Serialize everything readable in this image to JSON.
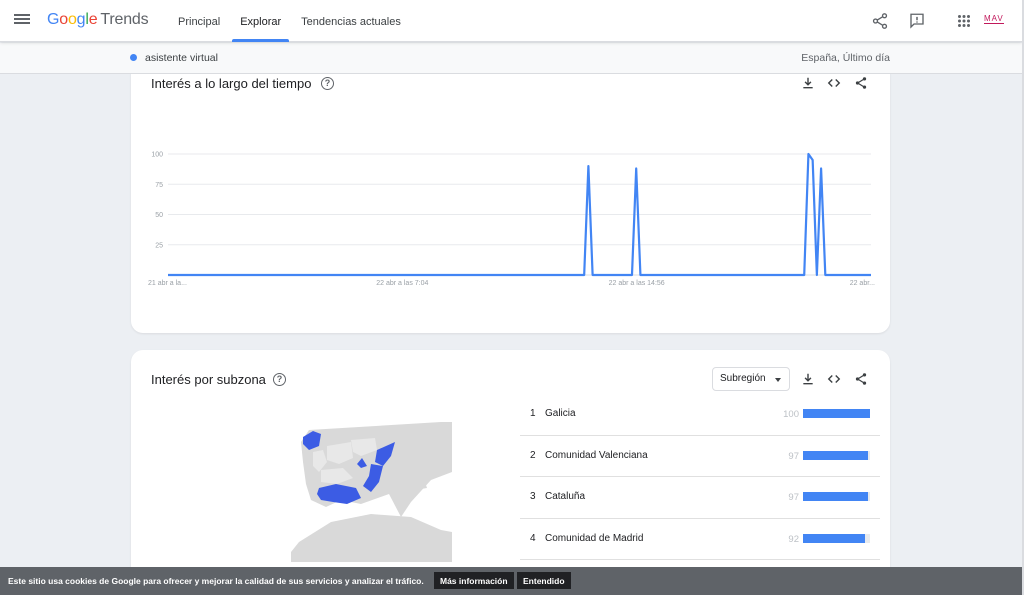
{
  "header": {
    "logo_google": [
      "G",
      "o",
      "o",
      "g",
      "l",
      "e"
    ],
    "logo_trends": "Trends",
    "tabs": [
      {
        "label": "Principal",
        "active": false
      },
      {
        "label": "Explorar",
        "active": true
      },
      {
        "label": "Tendencias actuales",
        "active": false
      }
    ],
    "icons": [
      "share-icon",
      "feedback-icon",
      "apps-icon"
    ],
    "avatar_text": "MAV"
  },
  "subbar": {
    "term": "asistente virtual",
    "term_color": "#4285f4",
    "region": "España, Último día"
  },
  "interest_over_time": {
    "title": "Interés a lo largo del tiempo",
    "help": "?",
    "icons": [
      "download-icon",
      "embed-icon",
      "share-icon"
    ]
  },
  "chart_data": {
    "type": "line",
    "series": [
      {
        "color": "#4285f4",
        "points": [
          [
            0,
            0
          ],
          [
            0.592,
            0
          ],
          [
            0.598,
            90
          ],
          [
            0.604,
            0
          ],
          [
            0.66,
            0
          ],
          [
            0.666,
            88
          ],
          [
            0.672,
            0
          ],
          [
            0.905,
            0
          ],
          [
            0.911,
            100
          ],
          [
            0.917,
            95
          ],
          [
            0.923,
            0
          ],
          [
            0.929,
            88
          ],
          [
            0.935,
            0
          ],
          [
            1,
            0
          ]
        ]
      }
    ],
    "y_ticks": [
      "100",
      "75",
      "50",
      "25"
    ],
    "x_ticks": [
      "21 abr a la...",
      "22 abr a las 7:04",
      "22 abr a las 14:56",
      "22 abr..."
    ],
    "ylim": [
      0,
      100
    ],
    "grid": true
  },
  "interest_by_subregion": {
    "title": "Interés por subzona",
    "help": "?",
    "dropdown_label": "Subregión",
    "icons": [
      "download-icon",
      "embed-icon",
      "share-icon"
    ],
    "ranking": [
      {
        "rank": "1",
        "name": "Galicia",
        "value": "100",
        "pct": 100
      },
      {
        "rank": "2",
        "name": "Comunidad Valenciana",
        "value": "97",
        "pct": 97
      },
      {
        "rank": "3",
        "name": "Cataluña",
        "value": "97",
        "pct": 97
      },
      {
        "rank": "4",
        "name": "Comunidad de Madrid",
        "value": "92",
        "pct": 92
      }
    ]
  },
  "cookie_bar": {
    "message": "Este sitio usa cookies de Google para ofrecer y mejorar la calidad de sus servicios y analizar el tráfico.",
    "more_info": "Más información",
    "accept": "Entendido"
  }
}
